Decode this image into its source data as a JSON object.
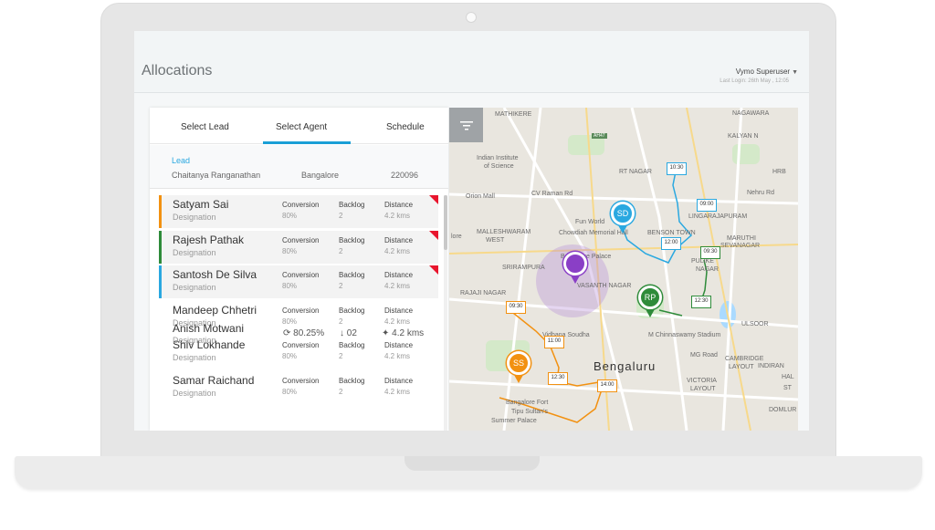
{
  "app": {
    "title": "Allocations",
    "user": "Vymo Superuser",
    "last_login": "Last Login: 26th May , 12:05"
  },
  "tabs": [
    "Select Lead",
    "Select Agent",
    "Schedule"
  ],
  "lead": {
    "label": "Lead",
    "name": "Chaitanya Ranganathan",
    "city": "Bangalore",
    "pin": "220096"
  },
  "columns": {
    "conversion": "Conversion",
    "backlog": "Backlog",
    "distance": "Distance"
  },
  "agents": [
    {
      "name": "Satyam Sai",
      "designation": "Designation",
      "conversion": "80%",
      "backlog": "2",
      "distance": "4.2 kms",
      "color": "#f29111",
      "flag": true
    },
    {
      "name": "Rajesh Pathak",
      "designation": "Designation",
      "conversion": "80%",
      "backlog": "2",
      "distance": "4.2 kms",
      "color": "#2e8b3a",
      "flag": true
    },
    {
      "name": "Santosh De Silva",
      "designation": "Designation",
      "conversion": "80%",
      "backlog": "2",
      "distance": "4.2 kms",
      "color": "#2aa8e0",
      "flag": true
    },
    {
      "name": "Mandeep Chhetri",
      "designation": "Designation",
      "conversion": "80%",
      "backlog": "2",
      "distance": "4.2 kms",
      "color": "",
      "flag": false
    },
    {
      "name": "Shiv Lokhande",
      "designation": "Designation",
      "conversion": "80%",
      "backlog": "2",
      "distance": "4.2 kms",
      "color": "",
      "flag": false
    },
    {
      "name": "Samar Raichand",
      "designation": "Designation",
      "conversion": "80%",
      "backlog": "2",
      "distance": "4.2 kms",
      "color": "",
      "flag": false
    }
  ],
  "last_agent": {
    "name": "Anish Motwani",
    "designation": "Designation",
    "conversion": "80.25%",
    "backlog": "02",
    "distance": "4.2 kms"
  },
  "map": {
    "labels": [
      "MATHIKERE",
      "NAGAWARA",
      "KALYAN N",
      "Indian Institute",
      "of Science",
      "RT NAGAR",
      "HRB",
      "Orion Mall",
      "CV Raman Rd",
      "Nehru Rd",
      "Fun World",
      "Chowdiah Memorial Hall",
      "MALLESHWARAM",
      "WEST",
      "BENSON TOWN",
      "LINGARAJAPURAM",
      "MARUTHI",
      "SEVANAGAR",
      "Bangalore Palace",
      "SRIRAMPURA",
      "PULIKE",
      "NAGAR",
      "RAJAJI NAGAR",
      "VASANTH NAGAR",
      "Vidhana Soudha",
      "ULSOOR",
      "M Chinnaswamy Stadium",
      "MG Road",
      "CAMBRIDGE",
      "LAYOUT",
      "INDIRAN",
      "Bengaluru",
      "VICTORIA",
      "LAYOUT",
      "HAL",
      "ST",
      "Bangalore Fort",
      "Tipu Sultan's",
      "Summer Palace",
      "DOMLUR",
      "AH47",
      "lore"
    ],
    "times": [
      "10:30",
      "09:00",
      "12:00",
      "09:30",
      "12:30",
      "09:30",
      "11:00",
      "12:30",
      "14:00"
    ],
    "markers": [
      {
        "label": "SD",
        "color": "#2aa8e0"
      },
      {
        "label": "RP",
        "color": "#2e8b3a"
      },
      {
        "label": "SS",
        "color": "#f29111"
      },
      {
        "label": "",
        "color": "#8a3fc6"
      }
    ]
  },
  "colors": {
    "accent": "#1a9fd6",
    "flag": "#e8152d",
    "orange": "#f29111",
    "green": "#2e8b3a",
    "blue": "#2aa8e0",
    "purple": "#8a3fc6"
  }
}
